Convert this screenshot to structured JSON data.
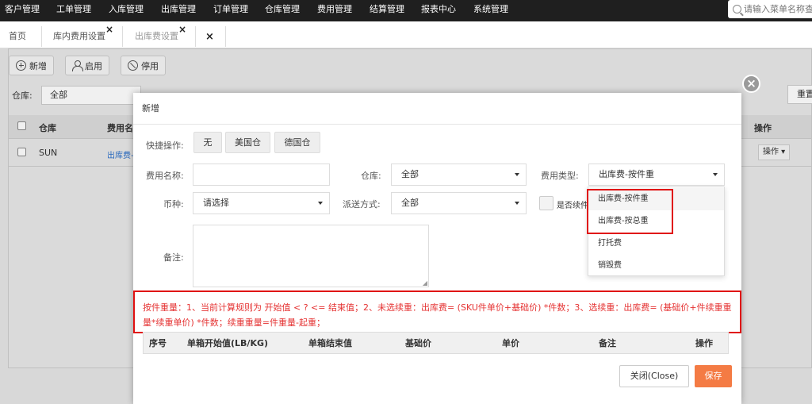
{
  "topnav": {
    "items": [
      "客户管理",
      "工单管理",
      "入库管理",
      "出库管理",
      "订单管理",
      "仓库管理",
      "费用管理",
      "结算管理",
      "报表中心",
      "系统管理"
    ],
    "search_placeholder": "请输入菜单名称查询"
  },
  "tabs": {
    "home": "首页",
    "t1": "库内费用设置",
    "t2": "出库费设置"
  },
  "toolbar": {
    "add": "新增",
    "enable": "启用",
    "disable": "停用"
  },
  "filters": {
    "warehouse_label": "仓库:",
    "warehouse_value": "全部",
    "reset": "重置"
  },
  "bg_table": {
    "headers": [
      "仓库",
      "费用名",
      "操作"
    ],
    "row": {
      "warehouse": "SUN",
      "fee": "出库费-",
      "action": "操作"
    }
  },
  "modal": {
    "title": "新增",
    "quick_label": "快捷操作:",
    "quick_buttons": [
      "无",
      "美国仓",
      "德国仓"
    ],
    "fee_name_label": "费用名称:",
    "warehouse_label": "仓库:",
    "warehouse_value": "全部",
    "fee_type_label": "费用类型:",
    "fee_type_value": "出库费-按件重",
    "currency_label": "币种:",
    "currency_value": "请选择",
    "delivery_label": "派送方式:",
    "delivery_value": "全部",
    "continue_label": "是否续件",
    "remark_label": "备注:",
    "dropdown_options": [
      "出库费-按件重",
      "出库费-按总重",
      "打托费",
      "销毁费"
    ],
    "note": "按件重量：1、当前计算规则为 开始值 < ? <= 结束值；2、未选续重：出库费= (SKU件单价+基础价) *件数；3、选续重：出库费= (基础价+件续重重量*续重单价) *件数；续重重量=件重量-起重；",
    "table_headers": [
      "序号",
      "单箱开始值(LB/KG)",
      "单箱结束值",
      "基础价",
      "单价",
      "备注",
      "操作"
    ],
    "close_btn": "关闭(Close)",
    "save_btn": "保存"
  },
  "colors": {
    "nav_bg": "#1f1f1f",
    "accent_orange": "#f47b44",
    "highlight_red": "#e01010"
  }
}
